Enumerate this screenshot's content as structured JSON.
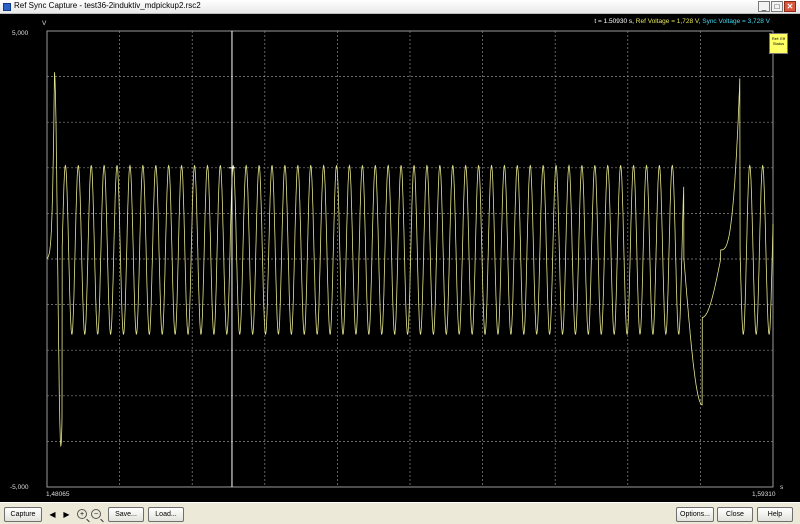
{
  "window": {
    "title": "Ref Sync Capture - test36-2induktiv_mdpickup2.rsc2",
    "minimize_glyph": "_",
    "maximize_glyph": "□",
    "close_glyph": "✕"
  },
  "readout": {
    "time": "t = 1.50930 s,",
    "ref": "Ref Voltage =  1,728 V,",
    "sync": "Sync Voltage =  3,728 V"
  },
  "axes": {
    "y_unit": "V",
    "y_top": "5,000",
    "y_bottom": "-5,000",
    "x_left": "1,48065",
    "x_right": "1,59310",
    "x_unit": "s"
  },
  "legend": {
    "line1": "Ref: Eff",
    "line2": "Status"
  },
  "toolbar": {
    "capture_label": "Capture",
    "prev_glyph": "◀",
    "next_glyph": "▶",
    "zoom_in_glyph": "+",
    "zoom_out_glyph": "−",
    "save_label": "Save...",
    "load_label": "Load...",
    "options_label": "Options...",
    "close_label": "Close",
    "help_label": "Help"
  },
  "colors": {
    "background": "#000000",
    "grid": "#8a8a8a",
    "ref_trace": "#e6e68c",
    "cursor": "#ffffff",
    "sync_text": "#44d8f0"
  },
  "chart_data": {
    "type": "line",
    "x_range": [
      1.48065,
      1.5931
    ],
    "y_range": [
      -5.0,
      5.0
    ],
    "grid": true,
    "cursor_x": 1.5093,
    "series": [
      {
        "name": "Ref Voltage",
        "description_points": "approximate envelope of oscillating signal",
        "points": [
          [
            1.48065,
            0.0
          ],
          [
            1.4813,
            0.4
          ],
          [
            1.4817,
            2.5
          ],
          [
            1.482,
            4.1
          ],
          [
            1.4828,
            1.0
          ],
          [
            1.4835,
            -0.7
          ],
          [
            1.4843,
            -1.2
          ],
          [
            1.485,
            2.0
          ],
          [
            1.486,
            -1.0
          ],
          [
            1.487,
            2.0
          ],
          [
            1.488,
            -1.0
          ],
          [
            1.489,
            2.0
          ],
          [
            1.58,
            0.0
          ],
          [
            1.582,
            -2.5
          ],
          [
            1.583,
            -3.2
          ],
          [
            1.584,
            -0.5
          ],
          [
            1.585,
            0.0
          ],
          [
            1.587,
            0.2
          ],
          [
            1.589,
            4.1
          ],
          [
            1.59,
            2.0
          ],
          [
            1.5931,
            2.0
          ]
        ]
      }
    ]
  }
}
